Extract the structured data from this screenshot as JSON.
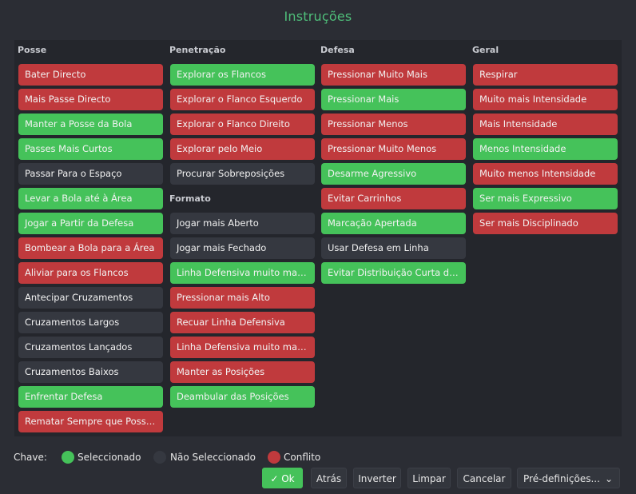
{
  "title": "Instruções",
  "colors": {
    "green": "#45c25a",
    "red": "#c03a3d",
    "grey": "#353840"
  },
  "columns": {
    "posse": {
      "label": "Posse",
      "items": [
        {
          "label": "Bater Directo",
          "state": "red"
        },
        {
          "label": "Mais Passe Directo",
          "state": "red"
        },
        {
          "label": "Manter a Posse da Bola",
          "state": "green"
        },
        {
          "label": "Passes Mais Curtos",
          "state": "green"
        },
        {
          "label": "Passar Para o Espaço",
          "state": "grey"
        },
        {
          "label": "Levar a Bola até à Área",
          "state": "green"
        },
        {
          "label": "Jogar a Partir da Defesa",
          "state": "green"
        },
        {
          "label": "Bombear a Bola para a Área",
          "state": "red"
        },
        {
          "label": "Aliviar para os Flancos",
          "state": "red"
        },
        {
          "label": "Antecipar Cruzamentos",
          "state": "grey"
        },
        {
          "label": "Cruzamentos Largos",
          "state": "grey"
        },
        {
          "label": "Cruzamentos Lançados",
          "state": "grey"
        },
        {
          "label": "Cruzamentos Baixos",
          "state": "grey"
        },
        {
          "label": "Enfrentar Defesa",
          "state": "green"
        },
        {
          "label": "Rematar Sempre que Possível",
          "state": "red"
        }
      ]
    },
    "penetracao": {
      "label": "Penetração",
      "items": [
        {
          "label": "Explorar os Flancos",
          "state": "green"
        },
        {
          "label": "Explorar o Flanco Esquerdo",
          "state": "red"
        },
        {
          "label": "Explorar o Flanco Direito",
          "state": "red"
        },
        {
          "label": "Explorar pelo Meio",
          "state": "red"
        },
        {
          "label": "Procurar Sobreposições",
          "state": "grey"
        }
      ]
    },
    "formato": {
      "label": "Formato",
      "items": [
        {
          "label": "Jogar mais Aberto",
          "state": "grey"
        },
        {
          "label": "Jogar mais Fechado",
          "state": "grey"
        },
        {
          "label": "Linha Defensiva muito mais ...",
          "state": "green"
        },
        {
          "label": "Pressionar mais Alto",
          "state": "red"
        },
        {
          "label": "Recuar Linha Defensiva",
          "state": "red"
        },
        {
          "label": "Linha Defensiva muito mais ...",
          "state": "red"
        },
        {
          "label": "Manter as Posições",
          "state": "red"
        },
        {
          "label": "Deambular das Posições",
          "state": "green"
        }
      ]
    },
    "defesa": {
      "label": "Defesa",
      "items": [
        {
          "label": "Pressionar Muito Mais",
          "state": "red"
        },
        {
          "label": "Pressionar Mais",
          "state": "green"
        },
        {
          "label": "Pressionar Menos",
          "state": "red"
        },
        {
          "label": "Pressionar Muito Menos",
          "state": "red"
        },
        {
          "label": "Desarme Agressivo",
          "state": "green"
        },
        {
          "label": "Evitar Carrinhos",
          "state": "red"
        },
        {
          "label": "Marcação Apertada",
          "state": "green"
        },
        {
          "label": "Usar Defesa em Linha",
          "state": "grey"
        },
        {
          "label": "Evitar Distribuição Curta do ...",
          "state": "green"
        }
      ]
    },
    "geral": {
      "label": "Geral",
      "items": [
        {
          "label": "Respirar",
          "state": "red"
        },
        {
          "label": "Muito mais Intensidade",
          "state": "red"
        },
        {
          "label": "Mais Intensidade",
          "state": "red"
        },
        {
          "label": "Menos Intensidade",
          "state": "green"
        },
        {
          "label": "Muito menos Intensidade",
          "state": "red"
        },
        {
          "label": "Ser mais Expressivo",
          "state": "green"
        },
        {
          "label": "Ser mais Disciplinado",
          "state": "red"
        }
      ]
    }
  },
  "legend": {
    "label": "Chave:",
    "selected": "Seleccionado",
    "not_selected": "Não Seleccionado",
    "conflict": "Conflito"
  },
  "footer": {
    "ok": "Ok",
    "back": "Atrás",
    "invert": "Inverter",
    "clear": "Limpar",
    "cancel": "Cancelar",
    "presets": "Pré-definições..."
  }
}
